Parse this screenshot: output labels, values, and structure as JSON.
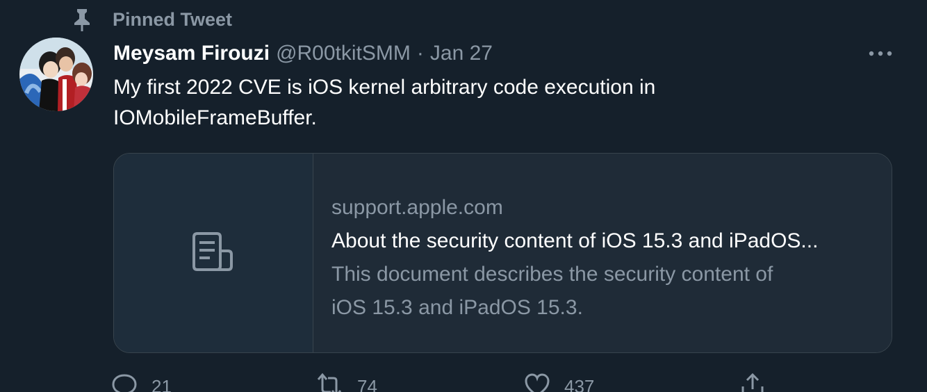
{
  "pinned": {
    "label": "Pinned Tweet",
    "icon": "pin-icon"
  },
  "tweet": {
    "author_name": "Meysam Firouzi",
    "author_handle": "@R00tkitSMM",
    "separator": "·",
    "date": "Jan 27",
    "text_line_1": "My first 2022 CVE is iOS kernel arbitrary code execution in",
    "text_line_2": "IOMobileFrameBuffer."
  },
  "card": {
    "domain": "support.apple.com",
    "title": "About the security content of iOS 15.3 and iPadOS...",
    "description_line_1": "This document describes the security content of",
    "description_line_2": "iOS 15.3 and iPadOS 15.3.",
    "icon": "document-icon"
  },
  "actions": {
    "reply_count": "21",
    "retweet_count": "74",
    "like_count": "437"
  },
  "colors": {
    "background": "#15202b",
    "secondary_text": "#8b98a5",
    "border": "#38444d"
  }
}
